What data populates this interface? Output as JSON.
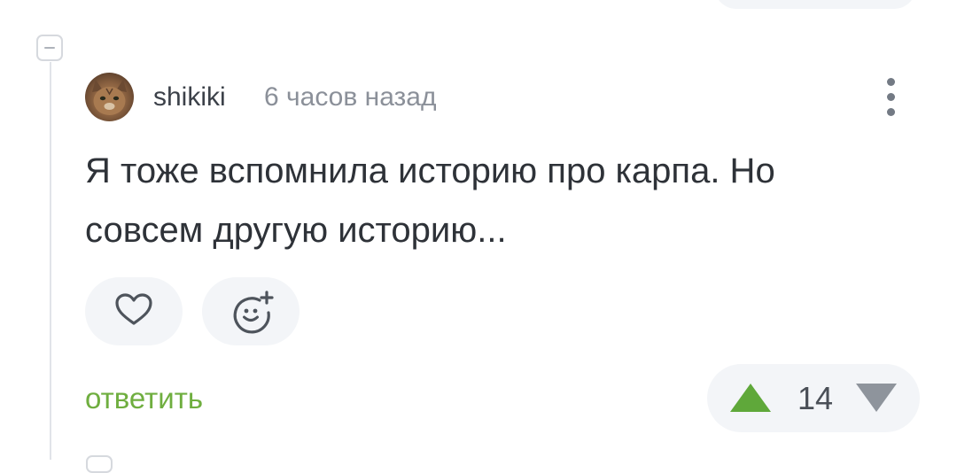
{
  "comment": {
    "author": "shikiki",
    "time": "6 часов назад",
    "text": "Я тоже вспомнила историю про карпа. Но совсем другую историю...",
    "reactions": [
      {
        "icon": "heart-icon"
      },
      {
        "icon": "add-emoji-icon"
      }
    ],
    "reply_label": "ответить",
    "rating": "14"
  },
  "colors": {
    "accent_green": "#6fae3f",
    "vote_up": "#5fa83a",
    "vote_down": "#8e949c",
    "pill_bg": "#f3f5f8",
    "text": "#2e3238",
    "muted": "#8b9099"
  }
}
